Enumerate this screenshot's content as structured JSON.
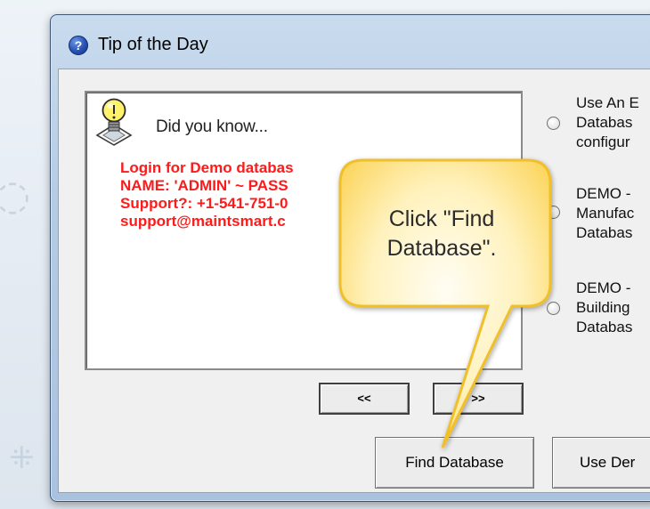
{
  "window": {
    "title": "Tip of the Day"
  },
  "tip": {
    "heading": "Did you know...",
    "lines": [
      "Login for Demo databas",
      "NAME: 'ADMIN' ~ PASS",
      "Support?: +1-541-751-0",
      "support@maintsmart.c"
    ]
  },
  "nav": {
    "prev_label": "<<",
    "next_label": ">>"
  },
  "options": [
    {
      "text": "Use An E\nDatabas\nconfigur"
    },
    {
      "text": "DEMO -\nManufac\nDatabas"
    },
    {
      "text": "DEMO -\nBuilding\nDatabas"
    }
  ],
  "buttons": {
    "find_database": "Find  Database",
    "use_demo": "Use Der"
  },
  "callout": {
    "text": "Click \"Find Database\"."
  },
  "colors": {
    "tip_text": "#ff1a1a",
    "callout_fill": "#fde27a",
    "window_frame": "#b4cbe4"
  }
}
